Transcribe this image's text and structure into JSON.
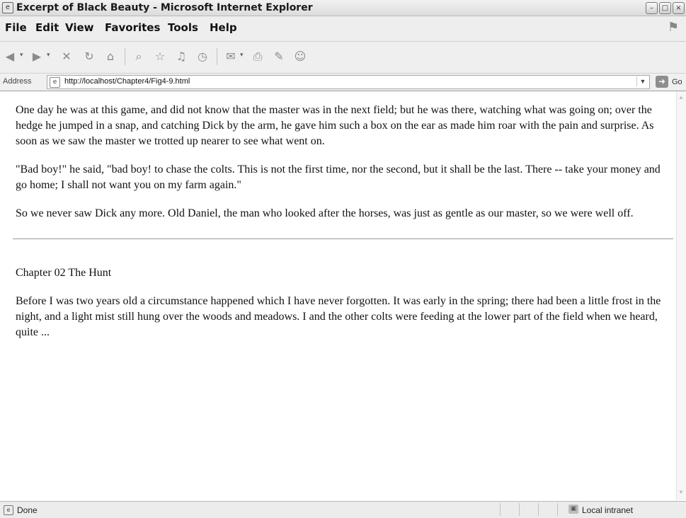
{
  "window": {
    "title": "Excerpt of Black Beauty - Microsoft Internet Explorer",
    "buttons": [
      "minimize-icon",
      "maximize-icon",
      "close-icon"
    ]
  },
  "menu": {
    "file": "File",
    "edit": "Edit",
    "view": "View",
    "favorites": "Favorites",
    "tools": "Tools",
    "help": "Help"
  },
  "toolbar": {
    "icons": [
      "back-icon",
      "forward-icon",
      "stop-icon",
      "refresh-icon",
      "home-icon",
      "search-icon",
      "favorites-icon",
      "media-icon",
      "history-icon",
      "mail-icon",
      "print-icon",
      "edit-icon",
      "messenger-icon"
    ]
  },
  "address": {
    "label": "Address",
    "url": "http://localhost/Chapter4/Fig4-9.html",
    "go": "Go"
  },
  "content": {
    "paragraph_1": "One day he was at this game, and did not know that the master was in the next field; but he was there, watching what was going on; over the hedge he jumped in a snap, and catching Dick by the arm, he gave him such a box on the ear as made him roar with the pain and surprise. As soon as we saw the master we trotted up nearer to see what went on.",
    "paragraph_2": "\"Bad boy!\" he said, \"bad boy! to chase the colts. This is not the first time, nor the second, but it shall be the last. There -- take your money and go home; I shall not want you on my farm again.\"",
    "paragraph_3": "So we never saw Dick any more. Old Daniel, the man who looked after the horses, was just as gentle as our master, so we were well off.",
    "chapter_heading": "Chapter 02 The Hunt",
    "paragraph_4": "Before I was two years old a circumstance happened which I have never forgotten. It was early in the spring; there had been a little frost in the night, and a light mist still hung over the woods and meadows. I and the other colts were feeding at the lower part of the field when we heard, quite ..."
  },
  "status": {
    "text": "Done",
    "zone": "Local intranet"
  }
}
